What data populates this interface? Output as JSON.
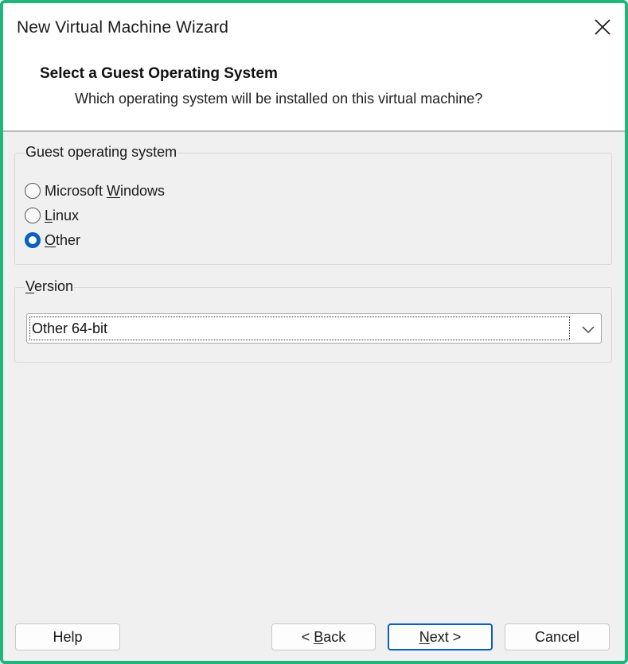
{
  "window": {
    "title": "New Virtual Machine Wizard",
    "close_icon": "close-icon"
  },
  "header": {
    "title": "Select a Guest Operating System",
    "subtitle": "Which operating system will be installed on this virtual machine?"
  },
  "guest_os": {
    "legend": "Guest operating system",
    "options": [
      {
        "before": "Microsoft ",
        "mnemonic": "W",
        "after": "indows",
        "selected": false
      },
      {
        "before": "",
        "mnemonic": "L",
        "after": "inux",
        "selected": false
      },
      {
        "before": "",
        "mnemonic": "O",
        "after": "ther",
        "selected": true
      }
    ]
  },
  "version": {
    "legend_mnemonic": "V",
    "legend_rest": "ersion",
    "selected_value": "Other 64-bit",
    "arrow_icon": "chevron-down-icon"
  },
  "buttons": {
    "help": "Help",
    "back_before": "< ",
    "back_mnemonic": "B",
    "back_after": "ack",
    "next_mnemonic": "N",
    "next_after": "ext >",
    "cancel": "Cancel"
  },
  "colors": {
    "window_border": "#1fb57c",
    "accent": "#0a5fc0",
    "dialog_bg": "#f0f0f0"
  }
}
